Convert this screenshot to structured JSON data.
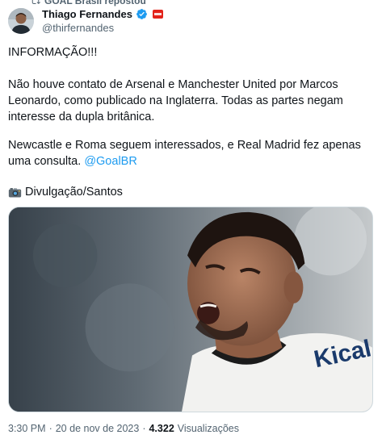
{
  "repost": {
    "label": "GOAL Brasil repostou"
  },
  "author": {
    "display_name": "Thiago Fernandes",
    "handle": "@thirfernandes",
    "verified": true,
    "affiliate_badge_color": "#e2231a"
  },
  "tweet": {
    "line1": "INFORMAÇÃO!!!",
    "paragraph2": "Não houve contato de Arsenal e Manchester United por Marcos Leonardo, como publicado na Inglaterra. Todas as partes negam interesse da dupla britânica.",
    "paragraph3_text": "Newcastle e Roma seguem interessados, e Real Madrid fez apenas uma consulta. ",
    "paragraph3_mention": "@GoalBR",
    "photo_credit": "Divulgação/Santos",
    "photo_credit_icon": "camera-icon"
  },
  "media": {
    "shirt_text": "Kical"
  },
  "meta": {
    "time": "3:30 PM",
    "separator": "·",
    "date": "20 de nov de 2023",
    "separator2": "·",
    "views_count": "4.322",
    "views_label": "Visualizações"
  },
  "colors": {
    "text": "#0f1419",
    "secondary": "#536471",
    "link": "#1d9bf0",
    "verified": "#1d9bf0"
  }
}
